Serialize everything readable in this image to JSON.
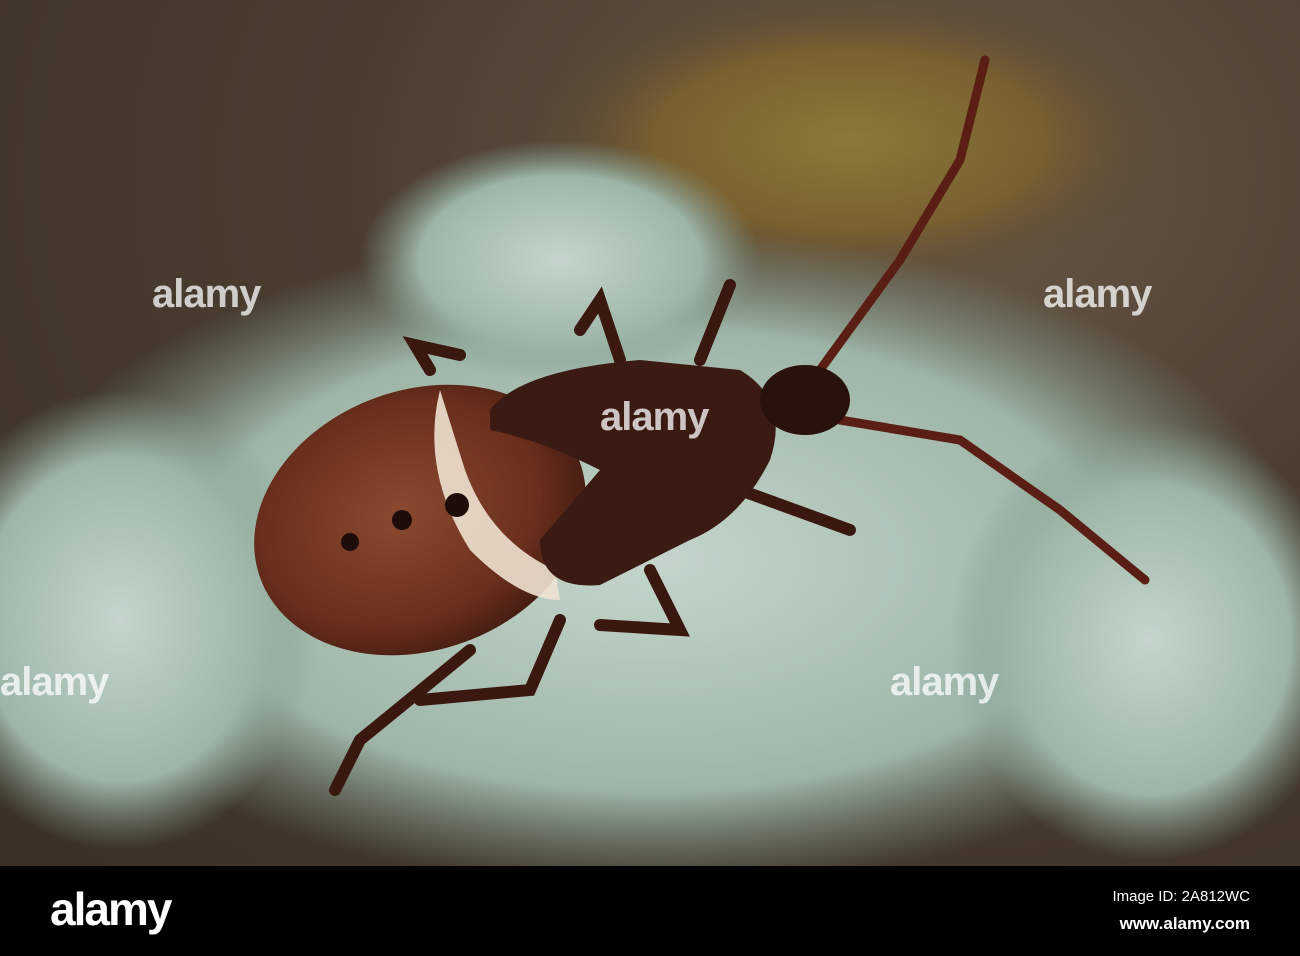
{
  "watermark": {
    "text": "alamy"
  },
  "footer": {
    "logo": "alamy",
    "image_id": "Image ID: 2A812WC",
    "url": "www.alamy.com"
  },
  "colors": {
    "background": "#3a3027",
    "lichen": "#a9c2b4",
    "bug_body": "#5a2a1c",
    "bug_stripe": "#f2e6d8"
  }
}
